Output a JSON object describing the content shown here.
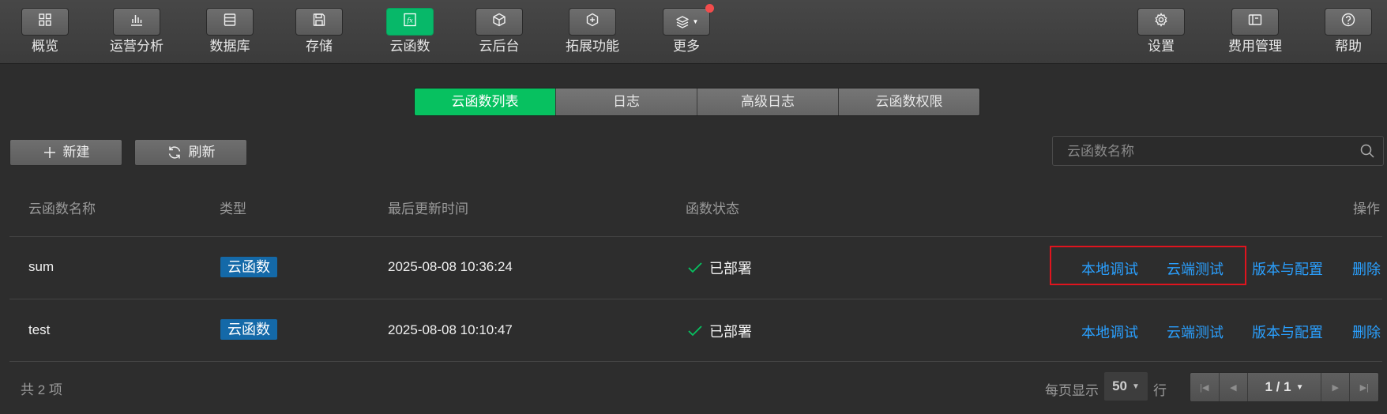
{
  "toolbar": {
    "left": [
      {
        "label": "概览",
        "icon": "grid-icon"
      },
      {
        "label": "运营分析",
        "icon": "bar-chart-icon"
      },
      {
        "label": "数据库",
        "icon": "database-icon"
      },
      {
        "label": "存储",
        "icon": "save-icon"
      },
      {
        "label": "云函数",
        "icon": "function-icon",
        "icon_text": "fx",
        "active": true
      },
      {
        "label": "云后台",
        "icon": "cube-icon"
      },
      {
        "label": "拓展功能",
        "icon": "extension-icon"
      },
      {
        "label": "更多",
        "icon": "layers-icon",
        "has_notification": true
      }
    ],
    "right": [
      {
        "label": "设置",
        "icon": "gear-icon"
      },
      {
        "label": "费用管理",
        "icon": "wallet-icon"
      },
      {
        "label": "帮助",
        "icon": "help-icon"
      }
    ]
  },
  "tabs": [
    "云函数列表",
    "日志",
    "高级日志",
    "云函数权限"
  ],
  "active_tab": "云函数列表",
  "actions": {
    "new_label": "新建",
    "refresh_label": "刷新"
  },
  "search": {
    "placeholder": "云函数名称",
    "value": ""
  },
  "table": {
    "headers": {
      "name": "云函数名称",
      "type": "类型",
      "updated": "最后更新时间",
      "status": "函数状态",
      "ops": "操作"
    },
    "rows": [
      {
        "name": "sum",
        "type": "云函数",
        "updated": "2025-08-08 10:36:24",
        "status": "已部署",
        "ops": [
          "本地调试",
          "云端测试",
          "版本与配置",
          "删除"
        ]
      },
      {
        "name": "test",
        "type": "云函数",
        "updated": "2025-08-08 10:10:47",
        "status": "已部署",
        "ops": [
          "本地调试",
          "云端测试",
          "版本与配置",
          "删除"
        ]
      }
    ]
  },
  "footer": {
    "total": "共 2 项",
    "per_page_prefix": "每页显示",
    "per_page_value": "50",
    "per_page_suffix": "行",
    "page": "1 / 1"
  },
  "colors": {
    "accent": "#07c160",
    "link": "#2aa0ff",
    "badge": "#1469a8",
    "highlight": "#e0141e"
  }
}
